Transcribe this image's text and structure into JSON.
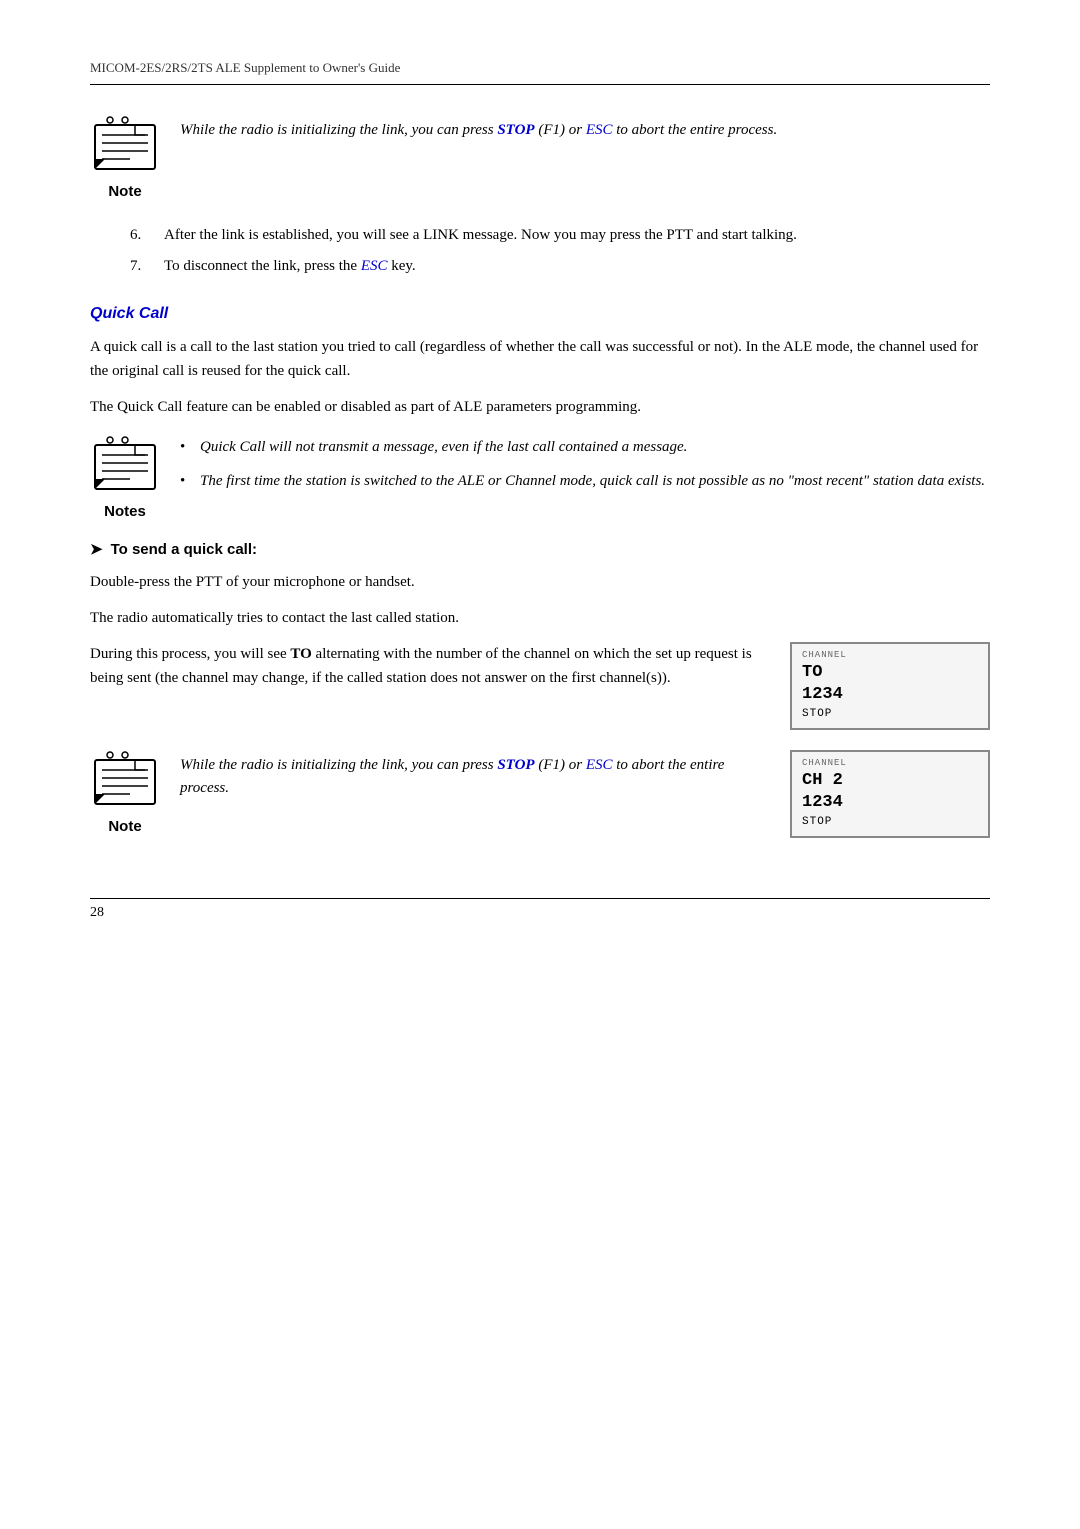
{
  "header": {
    "title": "MICOM-2ES/2RS/2TS ALE Supplement to Owner's Guide"
  },
  "top_note": {
    "icon_label": "Note",
    "text_part1": "While the radio is initializing the link, you can press ",
    "stop_word": "STOP",
    "text_part2": " (F1) or ",
    "esc_word": "ESC",
    "text_part3": " to abort the entire process."
  },
  "numbered_items": [
    {
      "num": "6.",
      "text": "After the link is established, you will see a LINK message. Now you may press the PTT and start talking."
    },
    {
      "num": "7.",
      "text_part1": "To disconnect the link, press the ",
      "esc_word": "ESC",
      "text_part2": " key."
    }
  ],
  "quick_call": {
    "title": "Quick Call",
    "para1": "A quick call is a call to the last station you tried to call (regardless of whether the call was successful or not). In the ALE mode, the channel used for the original call is reused for the quick call.",
    "para2": "The Quick Call feature can be enabled or disabled as part of ALE parameters programming."
  },
  "notes_box": {
    "icon_label": "Notes",
    "bullets": [
      "Quick Call will not transmit a message, even if the last call contained a message.",
      "The first time the station is switched to the ALE or Channel mode, quick call is not possible as no \"most recent\" station data exists."
    ]
  },
  "procedure": {
    "heading": "To send a quick call:",
    "step1": "Double-press the PTT of your microphone or handset.",
    "step2": "The radio automatically tries to contact the last called station.",
    "step3_part1": "During this process, you will see ",
    "step3_bold": "TO",
    "step3_part2": " alternating with the number of the channel on which the set up request is being sent (the channel may change, if the called station does not answer on the first channel(s))."
  },
  "display1": {
    "header": "CHANNEL",
    "line1": "TO",
    "line2": "1234",
    "stop": "STOP"
  },
  "display2": {
    "header": "CHANNEL",
    "line1": "CH 2",
    "line2": "1234",
    "stop": "STOP"
  },
  "bottom_note": {
    "icon_label": "Note",
    "text_part1": "While the radio is initializing the link, you can press ",
    "stop_word": "STOP",
    "text_part2": " (F1) or ",
    "esc_word": "ESC",
    "text_part3": " to abort the entire process."
  },
  "footer": {
    "page_number": "28"
  }
}
